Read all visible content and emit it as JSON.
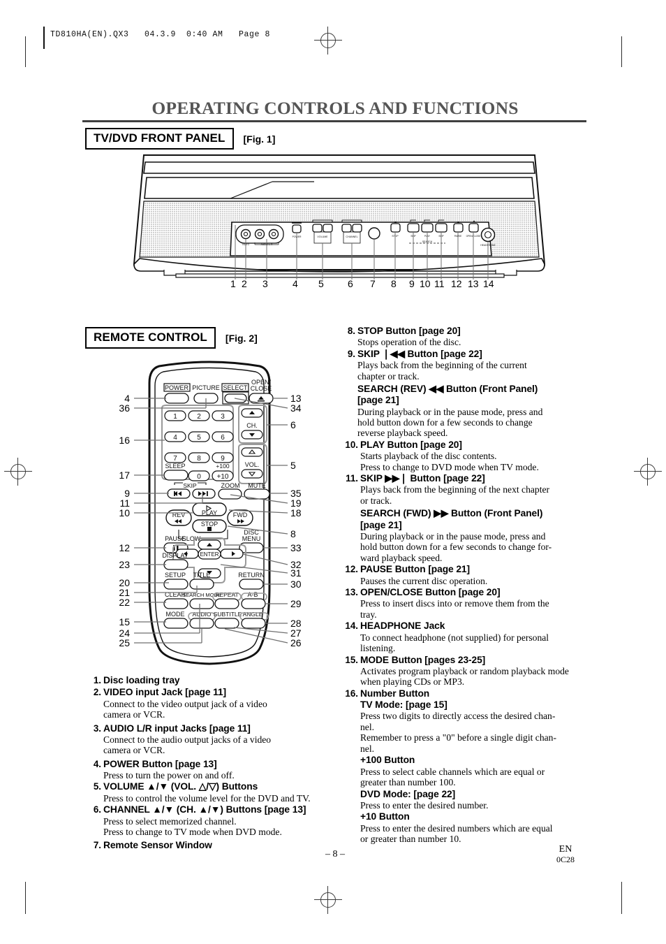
{
  "print_slug": "TD810HA(EN).QX3   04.3.9  0:40 AM   Page 8",
  "page_title": "OPERATING CONTROLS AND FUNCTIONS",
  "sections": {
    "front_panel": {
      "label": "TV/DVD FRONT PANEL",
      "figure": "[Fig. 1]"
    },
    "remote": {
      "label": "REMOTE CONTROL",
      "figure": "[Fig. 2]"
    }
  },
  "fig1": {
    "callouts": [
      "1",
      "2",
      "3",
      "4",
      "5",
      "6",
      "7",
      "8",
      "9",
      "10",
      "11",
      "12",
      "13",
      "14"
    ],
    "panel_labels": [
      "VIDEO",
      "AUDIO",
      "POWER",
      "VOLUME",
      "CHANNEL",
      "STOP",
      "SKIP",
      "PLAY",
      "SKIP",
      "PAUSE",
      "OPEN/CLOSE",
      "HEADPHONE"
    ]
  },
  "fig2": {
    "left_callouts": [
      "4",
      "36",
      "16",
      "17",
      "9",
      "11",
      "10",
      "12",
      "23",
      "20",
      "21",
      "22",
      "15",
      "24",
      "25"
    ],
    "right_callouts": [
      "13",
      "34",
      "6",
      "5",
      "35",
      "19",
      "18",
      "8",
      "33",
      "32",
      "31",
      "30",
      "29",
      "28",
      "27",
      "26"
    ],
    "buttons": {
      "power": "POWER",
      "picture": "PICTURE",
      "select": "SELECT",
      "open_close_line1": "OPEN/",
      "open_close_line2": "CLOSE",
      "numbers": [
        "1",
        "2",
        "3",
        "4",
        "5",
        "6",
        "7",
        "8",
        "9",
        "0"
      ],
      "plus100": "+100",
      "plus10": "+10",
      "sleep": "SLEEP",
      "ch": "CH.",
      "vol": "VOL.",
      "skip": "SKIP",
      "zoom": "ZOOM",
      "mute": "MUTE",
      "play": "PLAY",
      "rev": "REV",
      "fwd": "FWD",
      "stop": "STOP",
      "slow": "SLOW",
      "pause": "PAUSE",
      "disc_menu_line1": "DISC",
      "disc_menu_line2": "MENU",
      "display": "DISPLAY",
      "enter": "ENTER",
      "setup": "SETUP",
      "title": "TITLE",
      "return": "RETURN",
      "clear": "CLEAR",
      "search_mode": "SEARCH MODE",
      "repeat": "REPEAT",
      "ab": "A-B",
      "mode": "MODE",
      "audio": "AUDIO",
      "subtitle": "SUBTITLE",
      "angle": "ANGLE"
    }
  },
  "left_column": [
    {
      "num": "1.",
      "title": "Disc loading tray",
      "desc": []
    },
    {
      "num": "2.",
      "title": "VIDEO input Jack [page 11]",
      "desc": [
        "Connect to the video output jack of a video",
        "camera or VCR."
      ]
    },
    {
      "num": "3.",
      "title": "AUDIO L/R input Jacks [page 11]",
      "desc": [
        "Connect to the audio output jacks of a video",
        "camera or VCR."
      ]
    },
    {
      "num": "4.",
      "title": "POWER Button [page 13]",
      "desc": [
        "Press to turn the power on and off."
      ]
    },
    {
      "num": "5.",
      "title": "VOLUME ▲/▼ (VOL. △/▽) Buttons",
      "desc": [
        "Press to control the volume level for the DVD and TV."
      ]
    },
    {
      "num": "6.",
      "title": "CHANNEL ▲/▼ (CH. ▲/▼) Buttons [page 13]",
      "desc": [
        "Press to select memorized channel.",
        "Press to change to TV mode when DVD mode."
      ]
    },
    {
      "num": "7.",
      "title": "Remote Sensor Window",
      "desc": []
    }
  ],
  "right_column": [
    {
      "num": "8.",
      "title": "STOP Button [page 20]",
      "desc": [
        "Stops operation of the disc."
      ]
    },
    {
      "num": "9.",
      "title": "SKIP ❘◀◀ Button  [page 22]",
      "desc": [
        "Plays back from the beginning of the current",
        "chapter or track."
      ],
      "sub": [
        "SEARCH (REV) ◀◀ Button (Front Panel)",
        "[page 21]"
      ],
      "sub_desc": [
        "During playback or in the pause mode, press and",
        "hold button down for a few seconds to change",
        "reverse playback speed."
      ]
    },
    {
      "num": "10.",
      "title": "PLAY Button [page 20]",
      "desc": [
        "Starts playback of the disc contents.",
        "Press to change to DVD mode when TV mode."
      ]
    },
    {
      "num": "11.",
      "title": "SKIP ▶▶❘ Button [page 22]",
      "desc": [
        "Plays back from the beginning of the next chapter",
        "or track."
      ],
      "sub": [
        "SEARCH (FWD) ▶▶ Button (Front Panel)",
        "[page 21]"
      ],
      "sub_desc": [
        "During playback or in the pause mode, press and",
        "hold button down for a few seconds to change for-",
        "ward playback speed."
      ]
    },
    {
      "num": "12.",
      "title": "PAUSE Button [page 21]",
      "desc": [
        "Pauses the current disc operation."
      ]
    },
    {
      "num": "13.",
      "title": "OPEN/CLOSE Button [page 20]",
      "desc": [
        "Press to insert discs into or remove them from the",
        "tray."
      ]
    },
    {
      "num": "14.",
      "title": "HEADPHONE Jack",
      "desc": [
        "To connect headphone (not supplied) for personal",
        "listening."
      ]
    },
    {
      "num": "15.",
      "title": "MODE Button [pages 23-25]",
      "desc": [
        "Activates program playback or random playback mode",
        "when playing CDs or MP3."
      ]
    },
    {
      "num": "16.",
      "title": "Number Button",
      "sub": [
        "TV Mode: [page 15]"
      ],
      "sub_desc": [
        "Press two digits to directly access the desired chan-",
        "nel.",
        "Remember to press a \"0\" before a single digit chan-",
        "nel."
      ],
      "sub2": [
        "+100 Button"
      ],
      "sub2_desc": [
        "Press to select cable channels which are equal or",
        "greater than number 100."
      ],
      "sub3": [
        "DVD Mode: [page 22]"
      ],
      "sub3_desc": [
        "Press to enter the desired number."
      ],
      "sub4": [
        "+10 Button"
      ],
      "sub4_desc": [
        "Press to enter the desired numbers which are equal",
        "or greater than number 10."
      ]
    }
  ],
  "footer": {
    "page_number": "– 8 –",
    "lang": "EN",
    "code": "0C28"
  }
}
